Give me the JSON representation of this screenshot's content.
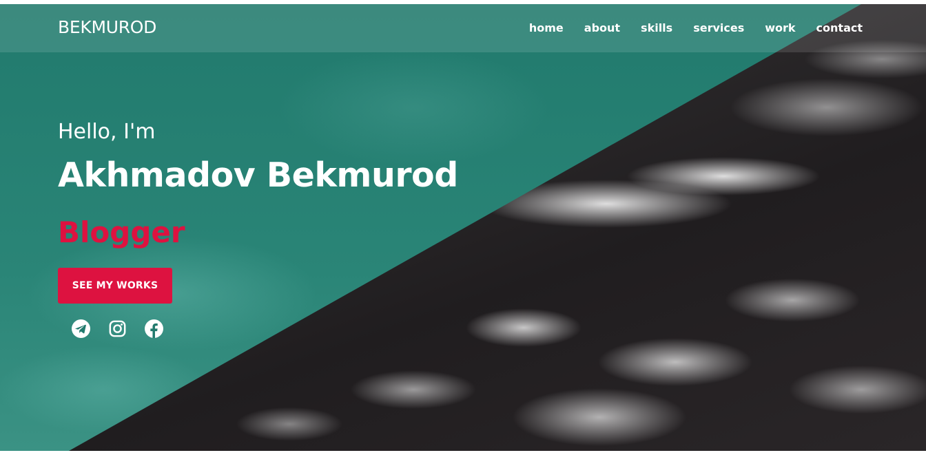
{
  "header": {
    "brand": "BEKMUROD",
    "nav": [
      "home",
      "about",
      "skills",
      "services",
      "work",
      "contact"
    ]
  },
  "hero": {
    "greeting": "Hello, I'm",
    "name": "Akhmadov Bekmurod",
    "role": "Blogger",
    "cta_label": "SEE MY WORKS",
    "socials": [
      {
        "name": "telegram",
        "icon": "telegram-icon"
      },
      {
        "name": "instagram",
        "icon": "instagram-icon"
      },
      {
        "name": "facebook",
        "icon": "facebook-icon"
      }
    ]
  },
  "colors": {
    "teal": "#217a6d",
    "accent": "#dd1240",
    "text": "#ffffff",
    "ocean_dark": "#201d1f"
  }
}
